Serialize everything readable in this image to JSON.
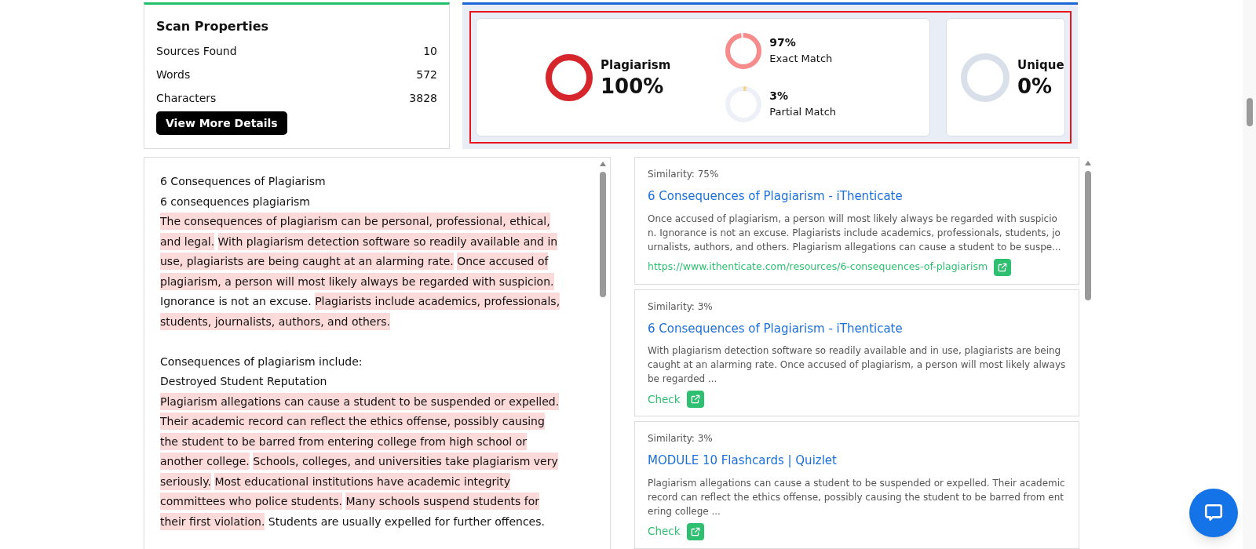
{
  "scan_properties": {
    "title": "Scan Properties",
    "rows": [
      {
        "label": "Sources Found",
        "value": "10"
      },
      {
        "label": "Words",
        "value": "572"
      },
      {
        "label": "Characters",
        "value": "3828"
      }
    ],
    "button": "View More Details"
  },
  "summary": {
    "plagiarism": {
      "label": "Plagiarism",
      "value": "100%",
      "level": 1
    },
    "matches": [
      {
        "kind": "exact",
        "value": "97%",
        "label": "Exact Match",
        "level": 0.97
      },
      {
        "kind": "partial",
        "value": "3%",
        "label": "Partial Match",
        "level": 0.03
      }
    ],
    "unique": {
      "label": "Unique",
      "value": "0%",
      "level": 0
    }
  },
  "document": {
    "blocks": [
      [
        [
          {
            "text": "6 Consequences of Plagiarism",
            "highlighted": false
          }
        ],
        [
          {
            "text": "6 consequences plagiarism",
            "highlighted": false
          }
        ],
        [
          {
            "text": "The consequences of plagiarism can be personal, professional, ethical,",
            "highlighted": true
          }
        ],
        [
          {
            "text": "and legal.",
            "highlighted": true
          },
          {
            "text": "With plagiarism detection software so readily available and in",
            "highlighted": true
          }
        ],
        [
          {
            "text": "use, plagiarists are being caught at an alarming rate.",
            "highlighted": true
          },
          {
            "text": "Once accused of",
            "highlighted": true
          }
        ],
        [
          {
            "text": "plagiarism, a person will most likely always be regarded with suspicion.",
            "highlighted": true
          }
        ],
        [
          {
            "text": "Ignorance is not an excuse.",
            "highlighted": false
          },
          {
            "text": "Plagiarists include academics, professionals,",
            "highlighted": true
          }
        ],
        [
          {
            "text": "students, journalists, authors, and others.",
            "highlighted": true
          }
        ]
      ],
      [
        [
          {
            "text": "Consequences of plagiarism include:",
            "highlighted": false
          }
        ],
        [
          {
            "text": "Destroyed Student Reputation",
            "highlighted": false
          }
        ],
        [
          {
            "text": "Plagiarism allegations can cause a student to be suspended or expelled.",
            "highlighted": true
          }
        ],
        [
          {
            "text": "Their academic record can reflect the ethics offense, possibly causing",
            "highlighted": true
          }
        ],
        [
          {
            "text": "the student to be barred from entering college from high school or",
            "highlighted": true
          }
        ],
        [
          {
            "text": "another college.",
            "highlighted": true
          },
          {
            "text": "Schools, colleges, and universities take plagiarism very",
            "highlighted": true
          }
        ],
        [
          {
            "text": "seriously.",
            "highlighted": true
          },
          {
            "text": "Most educational institutions have academic integrity",
            "highlighted": true
          }
        ],
        [
          {
            "text": "committees who police students.",
            "highlighted": true
          },
          {
            "text": "Many schools suspend students for",
            "highlighted": true
          }
        ],
        [
          {
            "text": "their first violation.",
            "highlighted": true
          },
          {
            "text": "Students are usually expelled for further offences.",
            "highlighted": false
          }
        ]
      ]
    ]
  },
  "sources": [
    {
      "similarity": "Similarity: 75%",
      "title": "6 Consequences of Plagiarism - iThenticate",
      "excerpt": "Once accused of plagiarism, a person will most likely always be regarded with suspicion. Ignorance is not an excuse. Plagiarists include academics, professionals, students, journalists, authors, and others. Plagiarism allegations can cause a student to be suspe...",
      "link": {
        "kind": "url",
        "text": "https://www.ithenticate.com/resources/6-consequences-of-plagiarism"
      }
    },
    {
      "similarity": "Similarity: 3%",
      "title": "6 Consequences of Plagiarism - iThenticate",
      "excerpt": "With plagiarism detection software so readily available and in use, plagiarists are being caught at an alarming rate. Once accused of plagiarism, a person will most likely always be regarded ...",
      "link": {
        "kind": "check",
        "text": "Check"
      }
    },
    {
      "similarity": "Similarity: 3%",
      "title": "MODULE 10 Flashcards | Quizlet",
      "excerpt": "Plagiarism allegations can cause a student to be suspended or expelled. Their academic record can reflect the ethics offense, possibly causing the student to be barred from entering college ...",
      "link": {
        "kind": "check",
        "text": "Check"
      }
    }
  ]
}
